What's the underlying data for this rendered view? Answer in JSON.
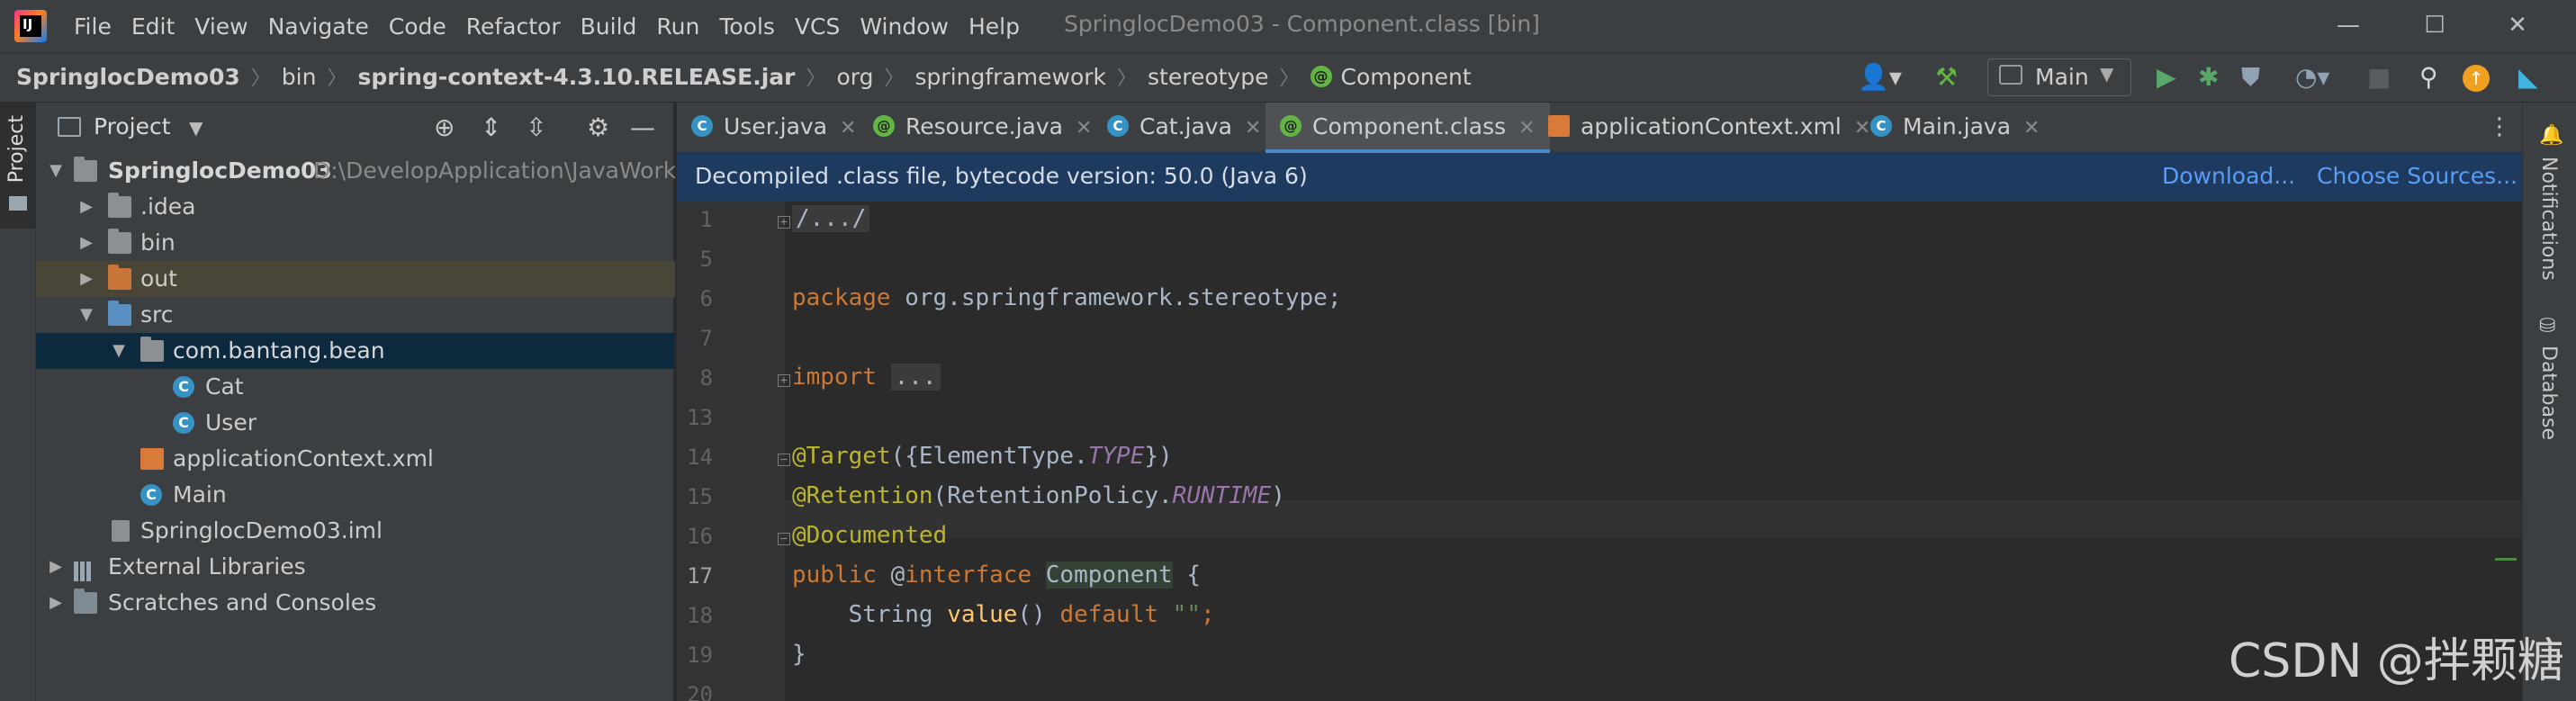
{
  "app": {
    "logo_text": "IJ",
    "menu": [
      "File",
      "Edit",
      "View",
      "Navigate",
      "Code",
      "Refactor",
      "Build",
      "Run",
      "Tools",
      "VCS",
      "Window",
      "Help"
    ],
    "window_title": "SpringlocDemo03 - Component.class [bin]",
    "window_controls": {
      "minimize": "—",
      "maximize": "☐",
      "close": "✕"
    }
  },
  "breadcrumb": [
    "SpringlocDemo03",
    "bin",
    "spring-context-4.3.10.RELEASE.jar",
    "org",
    "springframework",
    "stereotype",
    "Component"
  ],
  "toolbar": {
    "run_config": "Main",
    "icons": [
      "user-icon",
      "build-hammer-icon",
      "run-icon",
      "debug-icon",
      "coverage-icon",
      "profile-icon",
      "stop-icon",
      "search-icon",
      "update-icon",
      "plugin-icon"
    ]
  },
  "project_panel": {
    "side_tab": "Project",
    "title": "Project",
    "tree": [
      {
        "label": "SpringlocDemo03",
        "path": "D:\\DevelopApplication\\JavaWorkSp",
        "level": 0,
        "icon": "module-folder-icon",
        "expanded": true
      },
      {
        "label": ".idea",
        "level": 1,
        "icon": "folder-icon",
        "expanded": false
      },
      {
        "label": "bin",
        "level": 1,
        "icon": "folder-icon",
        "expanded": false
      },
      {
        "label": "out",
        "level": 1,
        "icon": "excluded-folder-icon",
        "expanded": false
      },
      {
        "label": "src",
        "level": 1,
        "icon": "source-folder-icon",
        "expanded": true
      },
      {
        "label": "com.bantang.bean",
        "level": 2,
        "icon": "package-icon",
        "expanded": true
      },
      {
        "label": "Cat",
        "level": 3,
        "icon": "class-icon"
      },
      {
        "label": "User",
        "level": 3,
        "icon": "class-icon"
      },
      {
        "label": "applicationContext.xml",
        "level": 2,
        "icon": "xml-file-icon"
      },
      {
        "label": "Main",
        "level": 2,
        "icon": "main-class-icon"
      },
      {
        "label": "SpringlocDemo03.iml",
        "level": 1,
        "icon": "iml-file-icon"
      },
      {
        "label": "External Libraries",
        "level": 0,
        "icon": "libraries-icon",
        "expanded": false
      },
      {
        "label": "Scratches and Consoles",
        "level": 0,
        "icon": "scratches-icon",
        "expanded": false
      }
    ]
  },
  "editor": {
    "tabs": [
      {
        "label": "User.java",
        "icon": "class-icon",
        "active": false
      },
      {
        "label": "Resource.java",
        "icon": "annotation-icon",
        "active": false
      },
      {
        "label": "Cat.java",
        "icon": "class-icon",
        "active": false
      },
      {
        "label": "Component.class",
        "icon": "annotation-icon",
        "active": true
      },
      {
        "label": "applicationContext.xml",
        "icon": "xml-file-icon",
        "active": false
      },
      {
        "label": "Main.java",
        "icon": "main-class-icon",
        "active": false
      }
    ],
    "banner": {
      "text": "Decompiled .class file, bytecode version: 50.0 (Java 6)",
      "download": "Download...",
      "choose_sources": "Choose Sources..."
    },
    "line_numbers": [
      "1",
      "5",
      "6",
      "7",
      "8",
      "13",
      "14",
      "15",
      "16",
      "17",
      "18",
      "19",
      "20"
    ],
    "current_line": "17",
    "code": {
      "l1": "/.../",
      "l6_kw": "package",
      "l6_rest": " org.springframework.stereotype;",
      "l8_kw": "import",
      "l8_fold": "...",
      "l14_ann": "@Target",
      "l14_a": "({ElementType.",
      "l14_enum": "TYPE",
      "l14_b": "})",
      "l15_ann": "@Retention",
      "l15_a": "(RetentionPolicy.",
      "l15_enum": "RUNTIME",
      "l15_b": ")",
      "l16_ann": "@Documented",
      "l17_kw1": "public",
      "l17_at": " @",
      "l17_kw2": "interface",
      "l17_sp": " ",
      "l17_name": "Component",
      "l17_brace": " {",
      "l18_indent": "    String ",
      "l18_method": "value",
      "l18_parens": "() ",
      "l18_kw": "default",
      "l18_sp": " ",
      "l18_str": "\"\"",
      "l18_semi": ";",
      "l19": "}"
    }
  },
  "right_strip": {
    "notifications": "Notifications",
    "database": "Database"
  },
  "watermark": "CSDN @拌颗糖"
}
